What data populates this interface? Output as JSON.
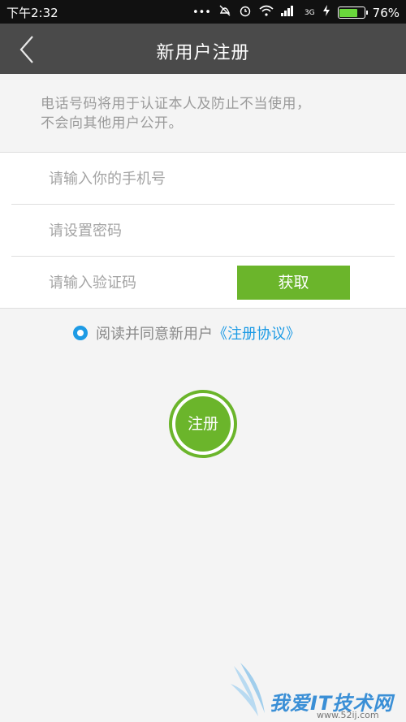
{
  "status": {
    "time": "下午2:32",
    "battery_percent": "76%",
    "battery_level": 0.76,
    "network": "3G",
    "icons": [
      "dots-icon",
      "mute-icon",
      "alarm-icon",
      "wifi-icon",
      "signal-icon",
      "charging-icon",
      "battery-icon"
    ]
  },
  "nav": {
    "title": "新用户注册",
    "back_icon": "back-arrow-icon"
  },
  "notice": {
    "line1": "电话号码将用于认证本人及防止不当使用，",
    "line2": "不会向其他用户公开。"
  },
  "form": {
    "phone_placeholder": "请输入你的手机号",
    "password_placeholder": "请设置密码",
    "code_placeholder": "请输入验证码",
    "get_code_label": "获取"
  },
  "agreement": {
    "text": "阅读并同意新用户",
    "link": "《注册协议》",
    "checked": true
  },
  "register_button": "注册",
  "watermark": {
    "text": "我爱IT技术网",
    "url": "www.52ij.com"
  },
  "colors": {
    "accent_green": "#6bb52b",
    "link_blue": "#1e9be5",
    "nav_bg": "#4a4a4a"
  }
}
